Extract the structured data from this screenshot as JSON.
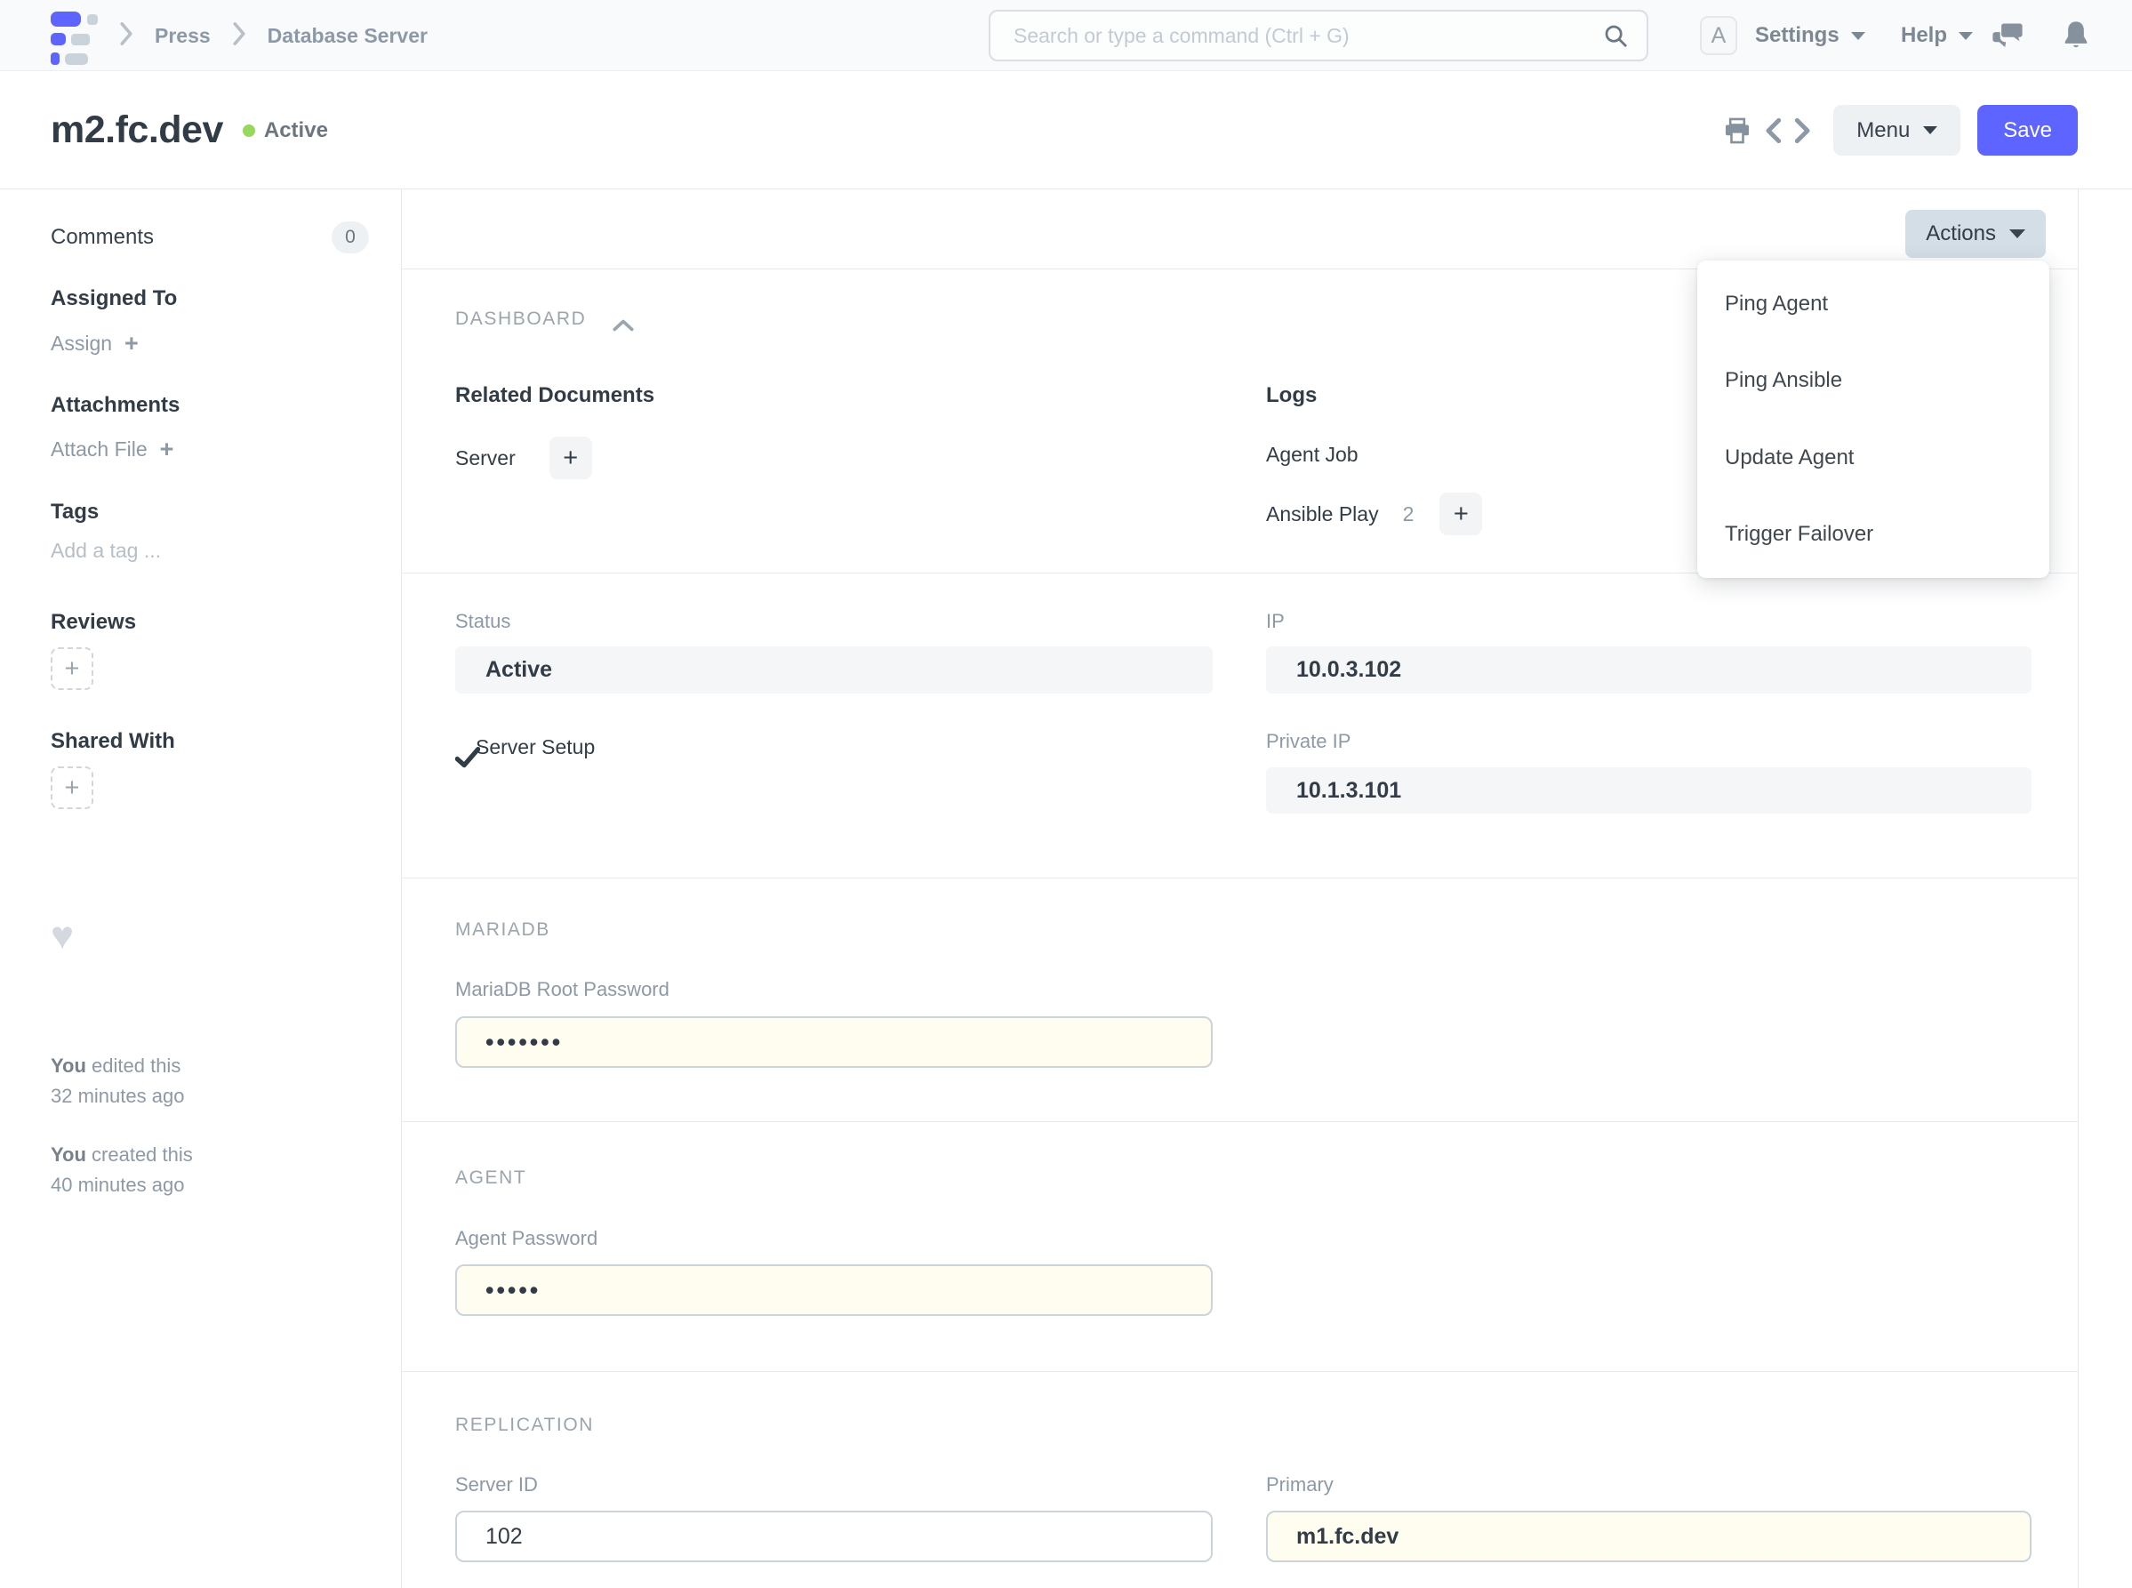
{
  "navbar": {
    "breadcrumbs": [
      "Press",
      "Database Server"
    ],
    "search_placeholder": "Search or type a command (Ctrl + G)",
    "avatar_letter": "A",
    "settings_label": "Settings",
    "help_label": "Help"
  },
  "title_bar": {
    "title": "m2.fc.dev",
    "status": "Active",
    "menu_label": "Menu",
    "save_label": "Save"
  },
  "actions_menu": {
    "button_label": "Actions",
    "items": [
      "Ping Agent",
      "Ping Ansible",
      "Update Agent",
      "Trigger Failover"
    ]
  },
  "sidebar": {
    "comments_label": "Comments",
    "comments_count": "0",
    "assigned_to_label": "Assigned To",
    "assign_label": "Assign",
    "attachments_label": "Attachments",
    "attach_file_label": "Attach File",
    "tags_label": "Tags",
    "add_tag_placeholder": "Add a tag ...",
    "reviews_label": "Reviews",
    "shared_with_label": "Shared With",
    "edited": {
      "who": "You",
      "action": " edited this",
      "when": "32 minutes ago"
    },
    "created": {
      "who": "You",
      "action": " created this",
      "when": "40 minutes ago"
    }
  },
  "dashboard": {
    "section_label": "DASHBOARD",
    "related_documents_label": "Related Documents",
    "server_label": "Server",
    "logs_label": "Logs",
    "agent_job_label": "Agent Job",
    "ansible_play_label": "Ansible Play",
    "ansible_play_count": "2"
  },
  "form": {
    "status": {
      "label": "Status",
      "value": "Active"
    },
    "server_setup_label": "Server Setup",
    "ip": {
      "label": "IP",
      "value": "10.0.3.102"
    },
    "private_ip": {
      "label": "Private IP",
      "value": "10.1.3.101"
    },
    "mariadb_section_label": "MARIADB",
    "mariadb_root_password": {
      "label": "MariaDB Root Password",
      "value": "•••••••"
    },
    "agent_section_label": "AGENT",
    "agent_password": {
      "label": "Agent Password",
      "value": "•••••"
    },
    "replication_section_label": "REPLICATION",
    "server_id": {
      "label": "Server ID",
      "value": "102"
    },
    "primary": {
      "label": "Primary",
      "value": "m1.fc.dev"
    }
  },
  "icons": {
    "plus": "+",
    "heart": "♥"
  },
  "colors": {
    "accent": "#5e64ff",
    "status_green": "#98d85b",
    "actions_button_bg": "#d3dee6",
    "password_field_bg": "#fffcf0",
    "readonly_field_bg": "#f4f6f7",
    "logo_gray": "#cbd3da"
  }
}
